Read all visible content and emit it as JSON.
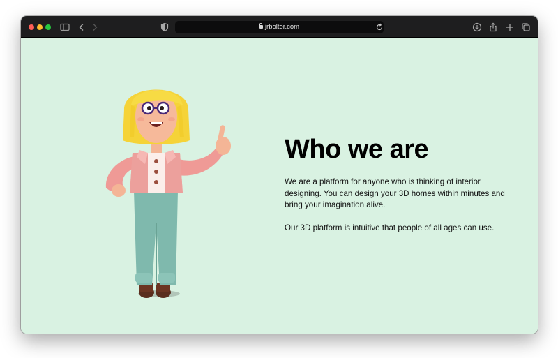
{
  "browser": {
    "url": "jrbolter.com",
    "icons": [
      "sidebar-icon",
      "back-icon",
      "forward-icon",
      "shield-icon",
      "lock-icon",
      "reload-icon",
      "download-icon",
      "share-icon",
      "new-tab-icon",
      "tabs-overview-icon"
    ]
  },
  "page": {
    "background": "#d9f2e2",
    "heading": "Who we are",
    "paragraph_1": "We are a platform for anyone who is thinking of interior designing. You can design your 3D homes within minutes and bring your imagination alive.",
    "paragraph_2": "Our 3D platform is intuitive that people of all ages can use."
  }
}
